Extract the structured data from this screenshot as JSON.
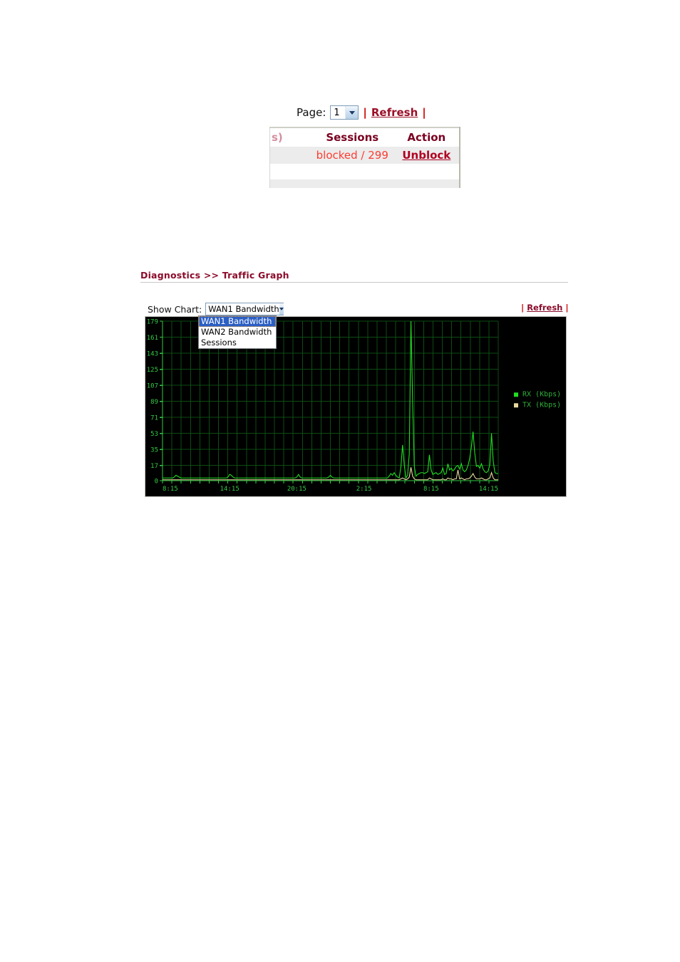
{
  "sessions_panel": {
    "page_label": "Page:",
    "page_value": "1",
    "separator": "|",
    "refresh_label": "Refresh",
    "columns": {
      "cut_off_header": "s)",
      "sessions": "Sessions",
      "action": "Action"
    },
    "rows": [
      {
        "blank": "",
        "sessions": "blocked / 299",
        "action": "Unblock"
      }
    ]
  },
  "traffic_graph": {
    "breadcrumb": "Diagnostics >> Traffic Graph",
    "show_chart_label": "Show Chart:",
    "selected_chart": "WAN1 Bandwidth",
    "separator": "|",
    "refresh_label": "Refresh",
    "chart_options": [
      "WAN1 Bandwidth",
      "WAN2 Bandwidth",
      "Sessions"
    ],
    "selected_option_index": 0
  },
  "colors": {
    "accent_red": "#8c0b2a",
    "link_red": "#b00020",
    "value_red": "#ff3b30",
    "chart_bg": "#000000",
    "grid_green": "#0d4d14",
    "axis_green": "#33cc44",
    "rx_green": "#22dd22",
    "tx_tan": "#e8d9a0",
    "dropdown_highlight": "#2b5fc4"
  },
  "chart_data": {
    "type": "line",
    "title": "",
    "xlabel": "",
    "ylabel": "",
    "ylim": [
      0,
      179
    ],
    "yticks": [
      0,
      17,
      35,
      53,
      71,
      89,
      107,
      125,
      143,
      161,
      179
    ],
    "xticks": [
      "8:15",
      "14:15",
      "20:15",
      "2:15",
      "8:15",
      "14:15"
    ],
    "xtick_positions": [
      0,
      36,
      72,
      108,
      144,
      180
    ],
    "grid": true,
    "legend_position": "right",
    "legend": [
      "TX (Kbps)",
      "RX (Kbps)"
    ],
    "series": [
      {
        "name": "RX (Kbps)",
        "color": "#22dd22",
        "values": [
          3,
          3,
          3,
          3,
          3,
          3,
          3,
          4,
          6,
          5,
          4,
          3,
          3,
          3,
          3,
          3,
          3,
          3,
          3,
          3,
          3,
          3,
          3,
          3,
          3,
          3,
          3,
          3,
          3,
          3,
          3,
          3,
          3,
          3,
          3,
          3,
          3,
          3,
          3,
          4,
          7,
          6,
          4,
          3,
          3,
          3,
          3,
          3,
          3,
          3,
          3,
          3,
          3,
          3,
          3,
          3,
          3,
          3,
          3,
          3,
          3,
          3,
          3,
          3,
          3,
          3,
          3,
          3,
          3,
          3,
          3,
          3,
          3,
          3,
          3,
          3,
          3,
          3,
          3,
          3,
          4,
          7,
          4,
          3,
          3,
          3,
          3,
          3,
          3,
          3,
          3,
          3,
          3,
          3,
          3,
          3,
          3,
          3,
          3,
          4,
          6,
          4,
          3,
          3,
          3,
          3,
          3,
          3,
          3,
          3,
          3,
          3,
          3,
          3,
          3,
          3,
          3,
          3,
          3,
          3,
          3,
          3,
          3,
          3,
          3,
          3,
          3,
          3,
          3,
          3,
          3,
          3,
          3,
          3,
          3,
          5,
          8,
          6,
          9,
          6,
          4,
          3,
          15,
          40,
          18,
          3,
          6,
          30,
          179,
          89,
          16,
          5,
          7,
          8,
          9,
          9,
          8,
          9,
          10,
          29,
          12,
          7,
          8,
          9,
          7,
          8,
          9,
          14,
          7,
          8,
          19,
          12,
          14,
          11,
          13,
          16,
          17,
          13,
          19,
          12,
          10,
          12,
          17,
          25,
          38,
          55,
          31,
          16,
          17,
          14,
          19,
          13,
          10,
          9,
          11,
          18,
          53,
          22,
          9,
          8,
          8
        ]
      },
      {
        "name": "TX (Kbps)",
        "color": "#e8d9a0",
        "values": [
          1,
          1,
          1,
          1,
          1,
          1,
          1,
          1,
          1,
          1,
          1,
          1,
          1,
          1,
          1,
          1,
          1,
          1,
          1,
          1,
          1,
          1,
          1,
          1,
          1,
          1,
          1,
          1,
          1,
          1,
          1,
          1,
          1,
          1,
          1,
          1,
          1,
          1,
          1,
          1,
          1,
          1,
          1,
          1,
          1,
          1,
          1,
          1,
          1,
          1,
          1,
          1,
          1,
          1,
          1,
          1,
          1,
          1,
          1,
          1,
          1,
          1,
          1,
          1,
          1,
          1,
          1,
          1,
          1,
          1,
          1,
          1,
          1,
          1,
          1,
          1,
          1,
          1,
          1,
          1,
          1,
          1,
          1,
          1,
          1,
          1,
          1,
          1,
          1,
          1,
          1,
          1,
          1,
          1,
          1,
          1,
          1,
          1,
          1,
          1,
          1,
          1,
          1,
          1,
          1,
          1,
          1,
          1,
          1,
          1,
          1,
          1,
          1,
          1,
          1,
          1,
          1,
          1,
          1,
          1,
          1,
          1,
          1,
          1,
          1,
          1,
          1,
          1,
          1,
          1,
          1,
          1,
          1,
          1,
          1,
          1,
          1,
          1,
          1,
          1,
          1,
          1,
          2,
          3,
          2,
          1,
          2,
          4,
          15,
          5,
          2,
          1,
          1,
          1,
          1,
          1,
          1,
          1,
          1,
          3,
          2,
          1,
          1,
          1,
          1,
          1,
          1,
          2,
          1,
          1,
          3,
          2,
          2,
          1,
          2,
          2,
          12,
          2,
          3,
          2,
          1,
          2,
          2,
          3,
          5,
          8,
          4,
          2,
          2,
          2,
          3,
          2,
          1,
          1,
          2,
          3,
          9,
          3,
          1,
          1,
          1
        ]
      }
    ]
  }
}
